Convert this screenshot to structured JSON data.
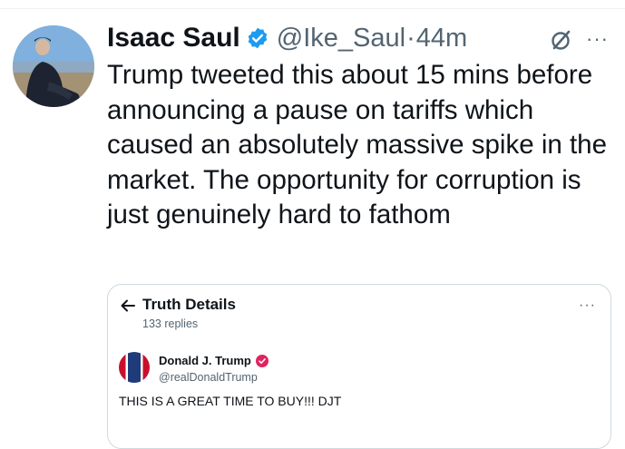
{
  "tweet": {
    "author_name": "Isaac Saul",
    "author_handle": "@Ike_Saul",
    "separator": "·",
    "time": "44m",
    "text": "Trump tweeted this about 15 mins before announcing a pause on tariffs which caused an absolutely massive spike in the market. The opportunity for corruption is just genuinely hard to fathom",
    "more_label": "···"
  },
  "quoted": {
    "title": "Truth Details",
    "replies": "133 replies",
    "more_label": "···",
    "author_name": "Donald J. Trump",
    "author_handle": "@realDonaldTrump",
    "text": "THIS IS A GREAT TIME TO BUY!!! DJT"
  },
  "icons": {
    "verified": "verified-badge-icon",
    "grok": "grok-icon",
    "back": "back-arrow-icon"
  },
  "colors": {
    "verified_blue": "#1d9bf0",
    "truth_badge": "#e0245e",
    "secondary_text": "#536471"
  }
}
